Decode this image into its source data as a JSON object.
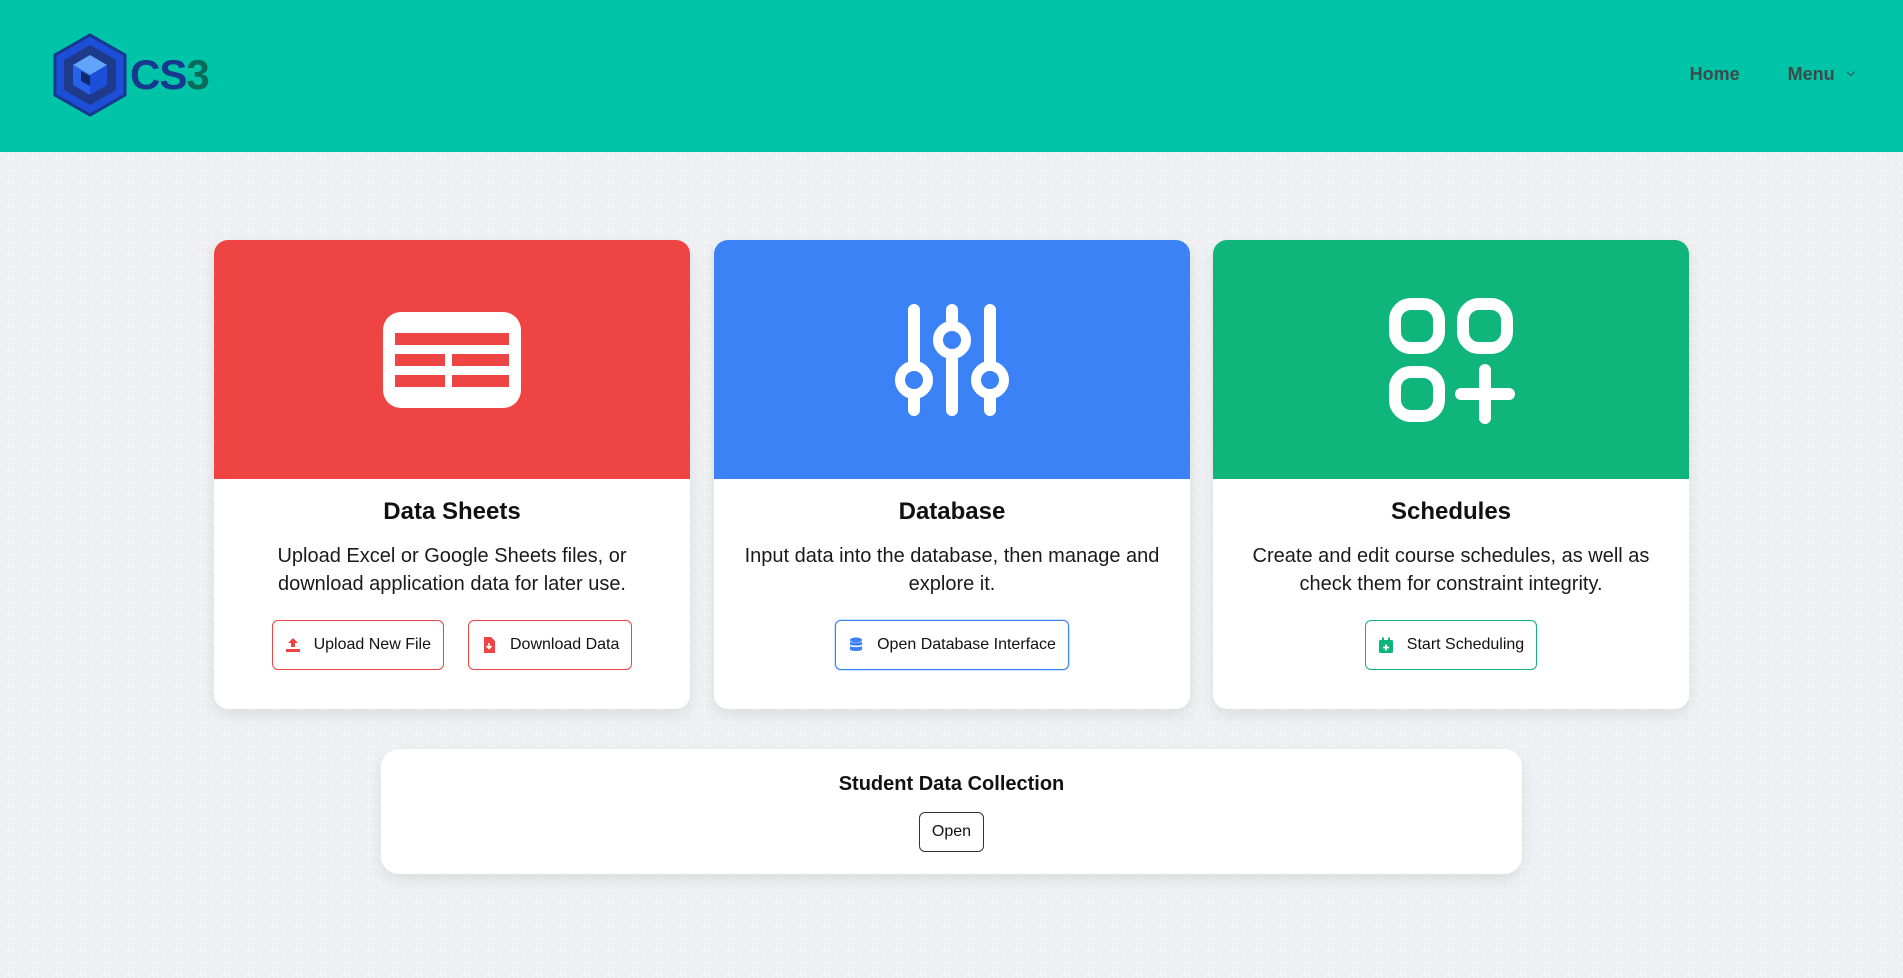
{
  "header": {
    "logo_text_main": "CS",
    "logo_text_accent": "3",
    "nav": {
      "home_label": "Home",
      "menu_label": "Menu"
    }
  },
  "cards": [
    {
      "title": "Data Sheets",
      "description": "Upload Excel or Google Sheets files, or download application data for later use.",
      "color": "#ef4444",
      "icon": "table-icon",
      "buttons": [
        {
          "label": "Upload New File",
          "icon": "upload-icon"
        },
        {
          "label": "Download Data",
          "icon": "file-download-icon"
        }
      ]
    },
    {
      "title": "Database",
      "description": "Input data into the database, then manage and explore it.",
      "color": "#3b82f6",
      "icon": "sliders-icon",
      "buttons": [
        {
          "label": "Open Database Interface",
          "icon": "database-icon"
        }
      ]
    },
    {
      "title": "Schedules",
      "description": "Create and edit course schedules, as well as check them for constraint integrity.",
      "color": "#10b57b",
      "icon": "apps-add-icon",
      "buttons": [
        {
          "label": "Start Scheduling",
          "icon": "calendar-plus-icon"
        }
      ]
    }
  ],
  "student_data": {
    "title": "Student Data Collection",
    "open_label": "Open"
  },
  "colors": {
    "header_bg": "#00c4a7",
    "brand_blue": "#16388e",
    "brand_green": "#0b6b5a"
  }
}
